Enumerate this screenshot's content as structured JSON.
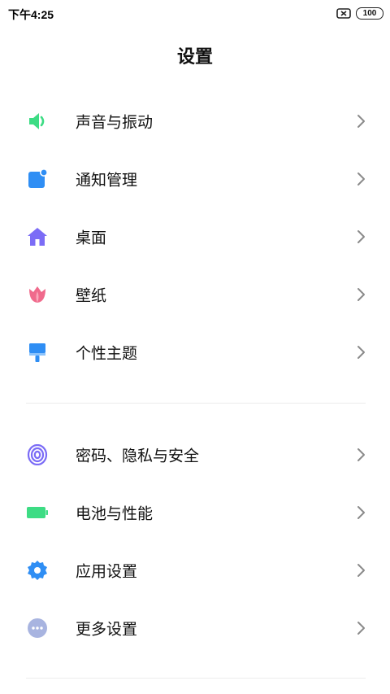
{
  "status_bar": {
    "time": "下午4:25",
    "battery_level": "100",
    "sim_icon": "no-sim-icon"
  },
  "page": {
    "title": "设置"
  },
  "groups": [
    {
      "items": [
        {
          "label": "声音与振动",
          "icon": "speaker-icon",
          "color": "#3ddc84"
        },
        {
          "label": "通知管理",
          "icon": "notification-icon",
          "color": "#2f8ef4"
        },
        {
          "label": "桌面",
          "icon": "home-icon",
          "color": "#7b6cf6"
        },
        {
          "label": "壁纸",
          "icon": "tulip-icon",
          "color": "#f06a8c"
        },
        {
          "label": "个性主题",
          "icon": "paint-brush-icon",
          "color": "#2f8ef4"
        }
      ]
    },
    {
      "items": [
        {
          "label": "密码、隐私与安全",
          "icon": "fingerprint-icon",
          "color": "#7b6cf6"
        },
        {
          "label": "电池与性能",
          "icon": "battery-icon",
          "color": "#3ddc84"
        },
        {
          "label": "应用设置",
          "icon": "gear-icon",
          "color": "#2f8ef4"
        },
        {
          "label": "更多设置",
          "icon": "more-dots-icon",
          "color": "#a8b4e0"
        }
      ]
    }
  ]
}
